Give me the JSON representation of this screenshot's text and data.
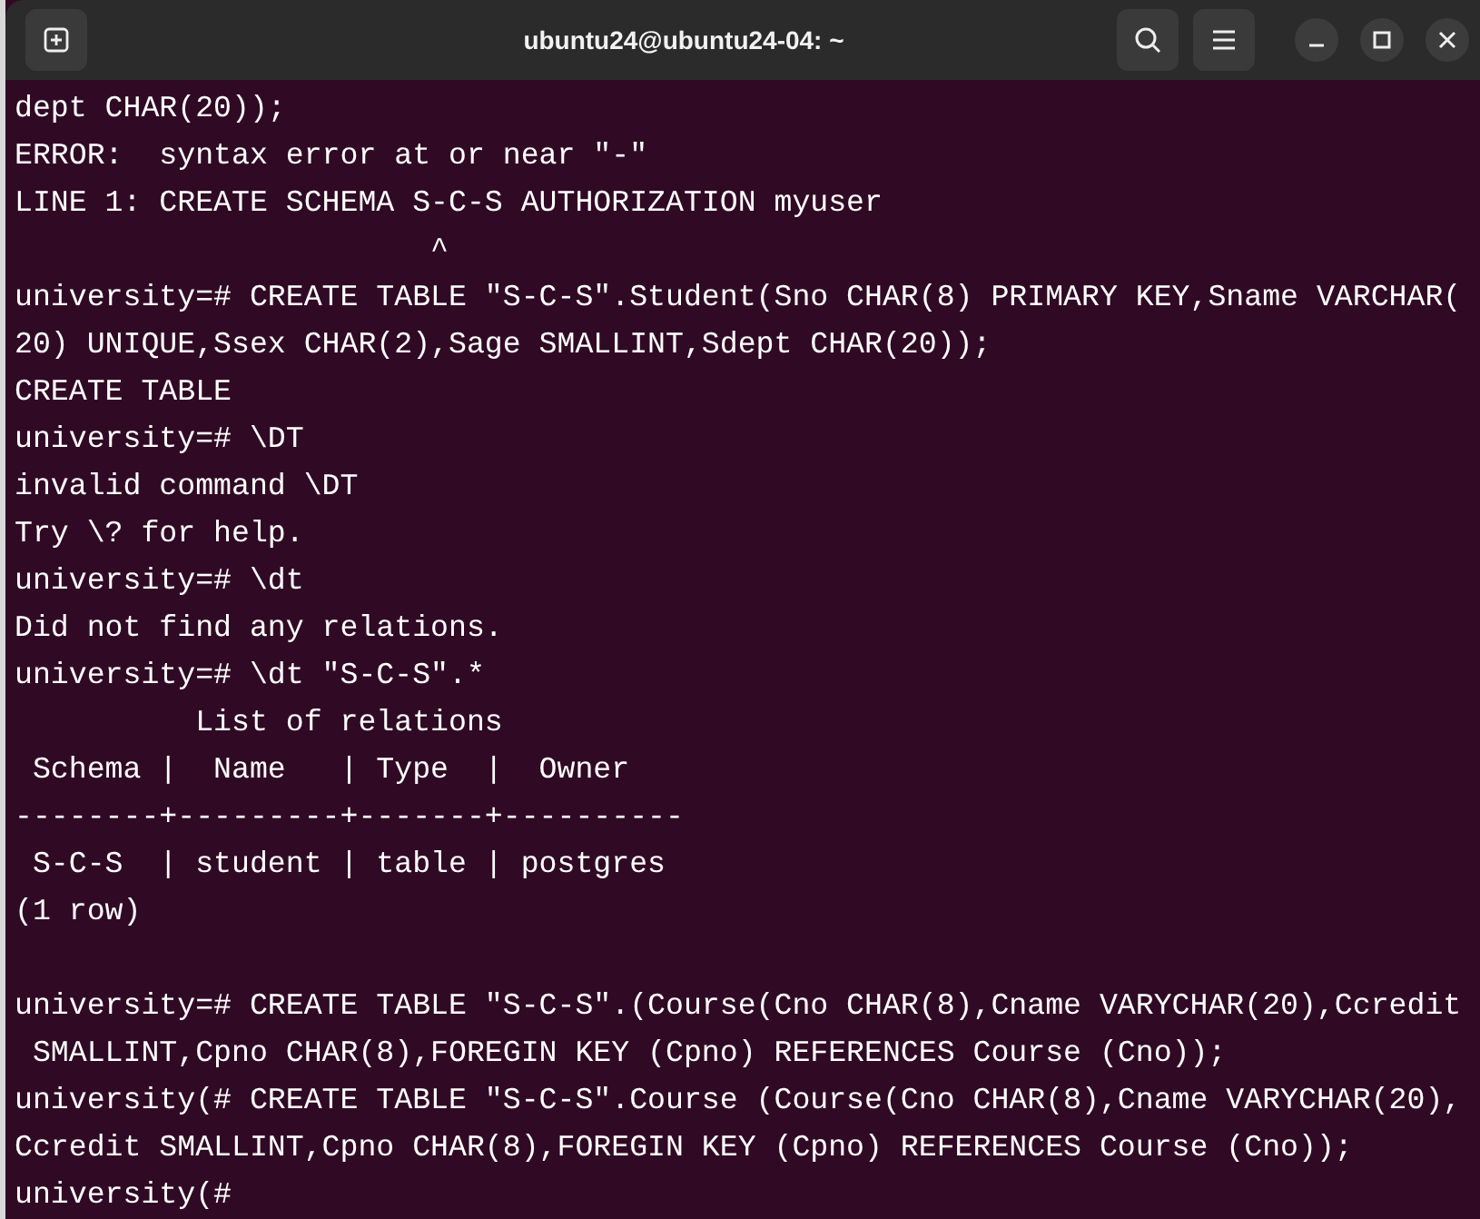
{
  "window": {
    "title": "ubuntu24@ubuntu24-04: ~"
  },
  "terminal": {
    "lines": [
      {
        "kind": "text",
        "text": "dept CHAR(20));"
      },
      {
        "kind": "text",
        "text": "ERROR:  syntax error at or near \"-\""
      },
      {
        "kind": "text",
        "text": "LINE 1: CREATE SCHEMA S-C-S AUTHORIZATION myuser"
      },
      {
        "kind": "text",
        "text": "                       ^"
      },
      {
        "kind": "text",
        "text": "university=# CREATE TABLE \"S-C-S\".Student(Sno CHAR(8) PRIMARY KEY,Sname VARCHAR("
      },
      {
        "kind": "text",
        "text": "20) UNIQUE,Ssex CHAR(2),Sage SMALLINT,Sdept CHAR(20));"
      },
      {
        "kind": "text",
        "text": "CREATE TABLE"
      },
      {
        "kind": "text",
        "text": "university=# \\DT"
      },
      {
        "kind": "text",
        "text": "invalid command \\DT"
      },
      {
        "kind": "text",
        "text": "Try \\? for help."
      },
      {
        "kind": "text",
        "text": "university=# \\dt"
      },
      {
        "kind": "text",
        "text": "Did not find any relations."
      },
      {
        "kind": "text",
        "text": "university=# \\dt \"S-C-S\".*"
      },
      {
        "kind": "text",
        "text": "          List of relations"
      },
      {
        "kind": "text",
        "text": " Schema |  Name   | Type  |  Owner"
      },
      {
        "kind": "text",
        "text": "--------+---------+-------+----------"
      },
      {
        "kind": "text",
        "text": " S-C-S  | student | table | postgres"
      },
      {
        "kind": "text",
        "text": "(1 row)"
      },
      {
        "kind": "blank"
      },
      {
        "kind": "text",
        "text": "university=# CREATE TABLE \"S-C-S\".(Course(Cno CHAR(8),Cname VARYCHAR(20),Ccredit"
      },
      {
        "kind": "text",
        "text": " SMALLINT,Cpno CHAR(8),FOREGIN KEY (Cpno) REFERENCES Course (Cno));"
      },
      {
        "kind": "text",
        "text": "university(# CREATE TABLE \"S-C-S\".Course (Course(Cno CHAR(8),Cname VARYCHAR(20),"
      },
      {
        "kind": "text",
        "text": "Ccredit SMALLINT,Cpno CHAR(8),FOREGIN KEY (Cpno) REFERENCES Course (Cno));"
      },
      {
        "kind": "text",
        "text": "university(# "
      }
    ]
  }
}
